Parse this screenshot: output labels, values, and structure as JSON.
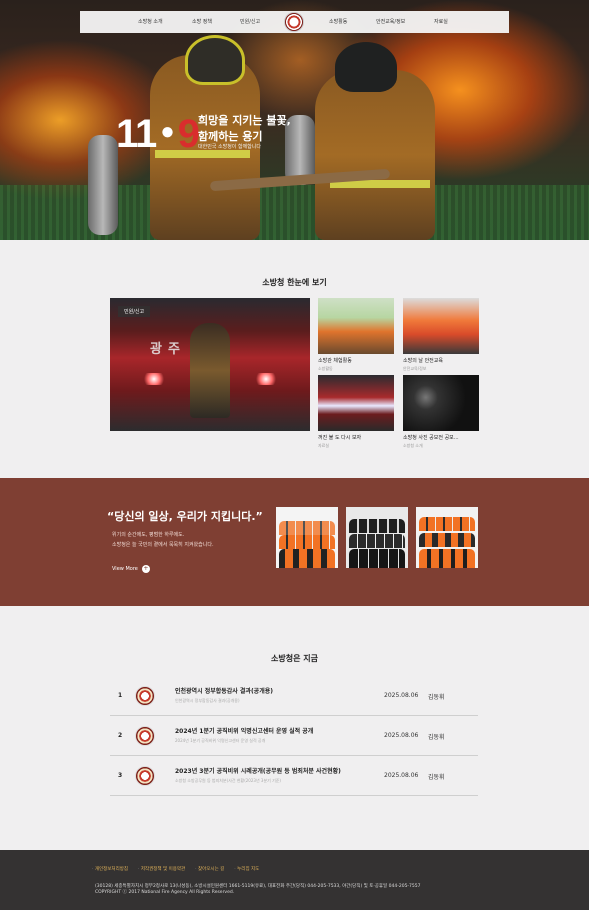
{
  "nav": {
    "items": [
      "소방청 소개",
      "소방 정책",
      "민원/신고",
      "소방활동",
      "안전교육/정보",
      "자료실"
    ]
  },
  "hero": {
    "number_left": "11",
    "number_right": "9",
    "headline_1": "희망을 지키는 불꽃,",
    "headline_2": "함께하는 용기",
    "subline": "대한민국 소방청이 함께합니다"
  },
  "overview": {
    "title": "소방청 한눈에 보기",
    "main_badge": "민원/신고",
    "main_image_text": "광주  소방",
    "thumbs": [
      {
        "caption": "소방관 체험활동",
        "category": "소방활동"
      },
      {
        "caption": "소방의 날 안전교육",
        "category": "안전교육/정보"
      },
      {
        "caption": "꺼진 불 도 다시 보자",
        "category": "자료실"
      },
      {
        "caption": "소방청 사진 공모전 공모...",
        "category": "소방청 소개"
      }
    ]
  },
  "band": {
    "quote": "“당신의 일상, 우리가 지킵니다.”",
    "sub_1": "위기의 순간에도, 평범한 하루에도.",
    "sub_2": "소방청은 늘 국민의 곁에서 묵묵히 지켜왔습니다.",
    "more_label": "View More",
    "more_icon": "+"
  },
  "news": {
    "title": "소방청은 지금",
    "rows": [
      {
        "num": "1",
        "title": "인천광역시 정부합동감사 결과(공개용)",
        "desc": "인천광역시 정부합동감사 결과(공개용)",
        "date": "2025.08.06",
        "author": "김동휘"
      },
      {
        "num": "2",
        "title": "2024년 1분기 공직비위 익명신고센터 운영 실적 공개",
        "desc": "2024년 1분기 공직비위 익명신고센터 운영 실적 공개",
        "date": "2025.08.06",
        "author": "김동휘"
      },
      {
        "num": "3",
        "title": "2023년 3분기 공직비위 시례공개(공무원 등 범죄처분 사건현황)",
        "desc": "소방청 소방공무원 등 범죄처분(사건 현황(2023년 3분기 기준)",
        "date": "2025.08.06",
        "author": "김동휘"
      }
    ]
  },
  "footer": {
    "links": [
      "개인정보처리방침",
      "저작권정책 및 이용약관",
      "찾아오시는 길",
      "누리집 지도"
    ],
    "address": "(30128) 세종특별자치시 정부2청사로 13(나성동), 소방시설민원센터 1661-5119(유료), 대표전화 주간(당직) 044-205-7533, 야간(당직) 및 토·공휴일 044-205-7557",
    "copyright": "COPYRIGHT ⓒ 2017 National Fire Agency All Rights Reserved."
  }
}
